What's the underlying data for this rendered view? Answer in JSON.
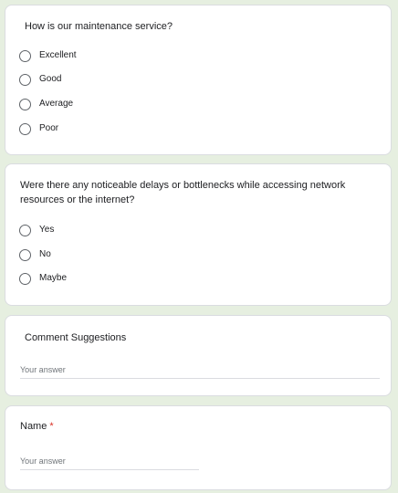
{
  "q1": {
    "title": "How is our maintenance service?",
    "options": [
      "Excellent",
      "Good",
      "Average",
      "Poor"
    ]
  },
  "q2": {
    "title_line1": "Were there any noticeable delays or bottlenecks while accessing network",
    "title_line2": "resources or the internet?",
    "options": [
      "Yes",
      "No",
      "Maybe"
    ]
  },
  "q3": {
    "title": "Comment Suggestions",
    "placeholder": "Your answer"
  },
  "q4": {
    "title": "Name",
    "required_mark": "*",
    "placeholder": "Your answer"
  },
  "colors": {
    "page_background": "#e6efe0",
    "card_background": "#ffffff",
    "required": "#d93025"
  }
}
